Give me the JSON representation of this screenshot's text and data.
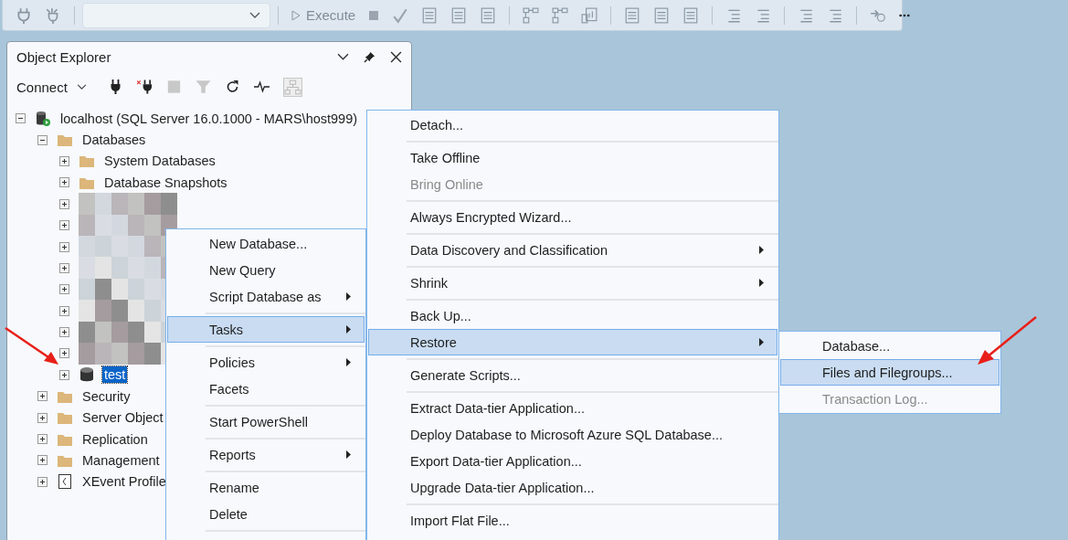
{
  "toolbar": {
    "execute_label": "Execute"
  },
  "object_explorer": {
    "title": "Object Explorer",
    "connect_label": "Connect",
    "tree": [
      {
        "label": "localhost (SQL Server 16.0.1000 - MARS\\host999)",
        "kind": "server",
        "expanded": true,
        "selected": false,
        "children": [
          {
            "label": "Databases",
            "kind": "folder",
            "expanded": true,
            "selected": false,
            "children": [
              {
                "label": "System Databases",
                "kind": "folder",
                "expanded": false,
                "selected": false
              },
              {
                "label": "Database Snapshots",
                "kind": "folder",
                "expanded": false,
                "selected": false
              },
              {
                "kind": "redacted",
                "expanded": false,
                "selected": false
              },
              {
                "kind": "redacted",
                "expanded": false,
                "selected": false
              },
              {
                "kind": "redacted",
                "expanded": false,
                "selected": false
              },
              {
                "kind": "redacted",
                "expanded": false,
                "selected": false
              },
              {
                "kind": "redacted",
                "expanded": false,
                "selected": false
              },
              {
                "kind": "redacted",
                "expanded": false,
                "selected": false
              },
              {
                "kind": "redacted",
                "expanded": false,
                "selected": false
              },
              {
                "kind": "redacted",
                "expanded": false,
                "selected": false
              },
              {
                "label": "test",
                "kind": "database",
                "expanded": false,
                "selected": true
              }
            ]
          },
          {
            "label": "Security",
            "kind": "folder",
            "expanded": false,
            "selected": false
          },
          {
            "label": "Server Object",
            "kind": "folder",
            "expanded": false,
            "selected": false
          },
          {
            "label": "Replication",
            "kind": "folder",
            "expanded": false,
            "selected": false
          },
          {
            "label": "Management",
            "kind": "folder",
            "expanded": false,
            "selected": false
          },
          {
            "label": "XEvent Profile",
            "kind": "xevent",
            "expanded": false,
            "selected": false
          }
        ]
      }
    ]
  },
  "context_menu": [
    {
      "kind": "item",
      "label": "New Database...",
      "selected": false,
      "disabled": false,
      "submenu": false
    },
    {
      "kind": "item",
      "label": "New Query",
      "selected": false,
      "disabled": false,
      "submenu": false
    },
    {
      "kind": "item",
      "label": "Script Database as",
      "selected": false,
      "disabled": false,
      "submenu": true
    },
    {
      "kind": "separator"
    },
    {
      "kind": "item",
      "label": "Tasks",
      "selected": true,
      "disabled": false,
      "submenu": true
    },
    {
      "kind": "separator"
    },
    {
      "kind": "item",
      "label": "Policies",
      "selected": false,
      "disabled": false,
      "submenu": true
    },
    {
      "kind": "item",
      "label": "Facets",
      "selected": false,
      "disabled": false,
      "submenu": false
    },
    {
      "kind": "separator"
    },
    {
      "kind": "item",
      "label": "Start PowerShell",
      "selected": false,
      "disabled": false,
      "submenu": false
    },
    {
      "kind": "separator"
    },
    {
      "kind": "item",
      "label": "Reports",
      "selected": false,
      "disabled": false,
      "submenu": true
    },
    {
      "kind": "separator"
    },
    {
      "kind": "item",
      "label": "Rename",
      "selected": false,
      "disabled": false,
      "submenu": false
    },
    {
      "kind": "item",
      "label": "Delete",
      "selected": false,
      "disabled": false,
      "submenu": false
    },
    {
      "kind": "separator"
    }
  ],
  "tasks_submenu": [
    {
      "kind": "item",
      "label": "Detach...",
      "selected": false,
      "disabled": false,
      "submenu": false
    },
    {
      "kind": "separator"
    },
    {
      "kind": "item",
      "label": "Take Offline",
      "selected": false,
      "disabled": false,
      "submenu": false
    },
    {
      "kind": "item",
      "label": "Bring Online",
      "selected": false,
      "disabled": true,
      "submenu": false
    },
    {
      "kind": "separator"
    },
    {
      "kind": "item",
      "label": "Always Encrypted Wizard...",
      "selected": false,
      "disabled": false,
      "submenu": false
    },
    {
      "kind": "separator"
    },
    {
      "kind": "item",
      "label": "Data Discovery and Classification",
      "selected": false,
      "disabled": false,
      "submenu": true
    },
    {
      "kind": "separator"
    },
    {
      "kind": "item",
      "label": "Shrink",
      "selected": false,
      "disabled": false,
      "submenu": true
    },
    {
      "kind": "separator"
    },
    {
      "kind": "item",
      "label": "Back Up...",
      "selected": false,
      "disabled": false,
      "submenu": false
    },
    {
      "kind": "item",
      "label": "Restore",
      "selected": true,
      "disabled": false,
      "submenu": true
    },
    {
      "kind": "separator"
    },
    {
      "kind": "item",
      "label": "Generate Scripts...",
      "selected": false,
      "disabled": false,
      "submenu": false
    },
    {
      "kind": "separator"
    },
    {
      "kind": "item",
      "label": "Extract Data-tier Application...",
      "selected": false,
      "disabled": false,
      "submenu": false
    },
    {
      "kind": "item",
      "label": "Deploy Database to Microsoft Azure SQL Database...",
      "selected": false,
      "disabled": false,
      "submenu": false
    },
    {
      "kind": "item",
      "label": "Export Data-tier Application...",
      "selected": false,
      "disabled": false,
      "submenu": false
    },
    {
      "kind": "item",
      "label": "Upgrade Data-tier Application...",
      "selected": false,
      "disabled": false,
      "submenu": false
    },
    {
      "kind": "separator"
    },
    {
      "kind": "item",
      "label": "Import Flat File...",
      "selected": false,
      "disabled": false,
      "submenu": false
    }
  ],
  "restore_submenu": [
    {
      "kind": "item",
      "label": "Database...",
      "selected": false,
      "disabled": false,
      "submenu": false
    },
    {
      "kind": "item",
      "label": "Files and Filegroups...",
      "selected": true,
      "disabled": false,
      "submenu": false
    },
    {
      "kind": "item",
      "label": "Transaction Log...",
      "selected": false,
      "disabled": true,
      "submenu": false
    }
  ]
}
